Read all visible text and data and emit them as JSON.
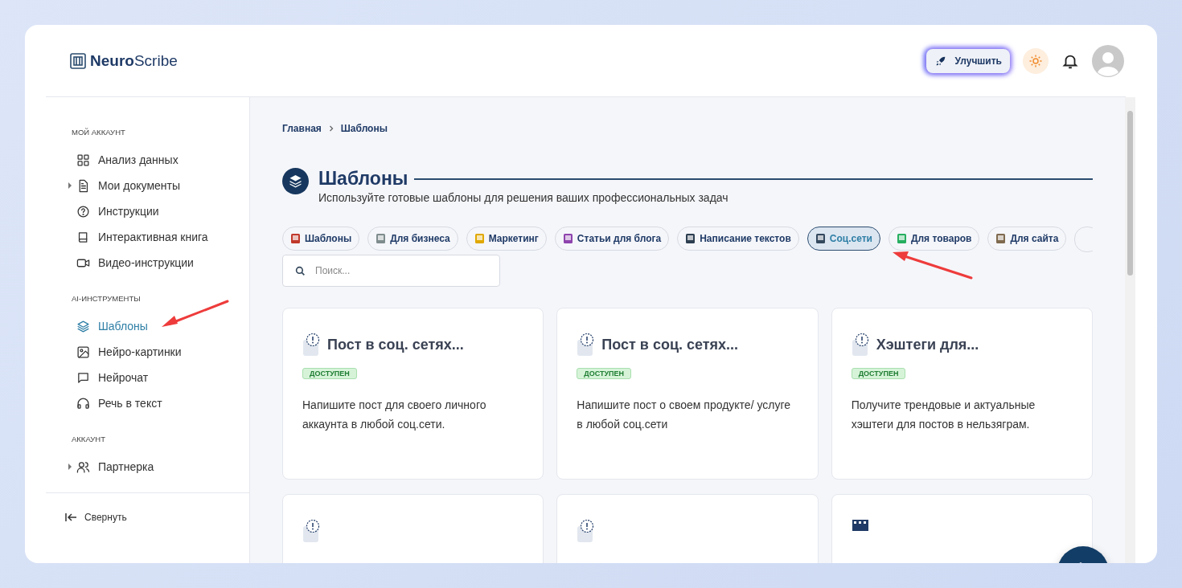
{
  "logo": {
    "bold": "Neuro",
    "light": "Scribe"
  },
  "header": {
    "upgrade_button": "Улучшить"
  },
  "sidebar": {
    "sections": [
      {
        "title": "МОЙ АККАУНТ",
        "items": [
          {
            "label": "Анализ данных",
            "expandable": false,
            "selected": false
          },
          {
            "label": "Мои документы",
            "expandable": true,
            "selected": false
          },
          {
            "label": "Инструкции",
            "expandable": false,
            "selected": false
          },
          {
            "label": "Интерактивная книга",
            "expandable": false,
            "selected": false
          },
          {
            "label": "Видео-инструкции",
            "expandable": false,
            "selected": false
          }
        ]
      },
      {
        "title": "AI-ИНСТРУМЕНТЫ",
        "items": [
          {
            "label": "Шаблоны",
            "expandable": false,
            "selected": true
          },
          {
            "label": "Нейро-картинки",
            "expandable": false,
            "selected": false
          },
          {
            "label": "Нейрочат",
            "expandable": false,
            "selected": false
          },
          {
            "label": "Речь в текст",
            "expandable": false,
            "selected": false
          }
        ]
      },
      {
        "title": "АККАУНТ",
        "items": [
          {
            "label": "Партнерка",
            "expandable": true,
            "selected": false
          }
        ]
      }
    ],
    "collapse": "Свернуть"
  },
  "breadcrumb": [
    "Главная",
    "Шаблоны"
  ],
  "page": {
    "title": "Шаблоны",
    "subtitle": "Используйте готовые шаблоны для решения ваших профессиональных задач"
  },
  "chips": [
    {
      "label": "Шаблоны",
      "selected": false
    },
    {
      "label": "Для бизнеса",
      "selected": false
    },
    {
      "label": "Маркетинг",
      "selected": false
    },
    {
      "label": "Статьи для блога",
      "selected": false
    },
    {
      "label": "Написание текстов",
      "selected": false
    },
    {
      "label": "Соц.сети",
      "selected": true
    },
    {
      "label": "Для товаров",
      "selected": false
    },
    {
      "label": "Для сайта",
      "selected": false
    }
  ],
  "search": {
    "placeholder": "Поиск..."
  },
  "cards": [
    {
      "title": "Пост в соц. сетях...",
      "badge": "ДОСТУПЕН",
      "description": "Напишите пост для своего личного аккаунта в любой соц.сети."
    },
    {
      "title": "Пост в соц. сетях...",
      "badge": "ДОСТУПЕН",
      "description": "Напишите пост о своем продукте/ услуге в любой соц.сети"
    },
    {
      "title": "Хэштеги для...",
      "badge": "ДОСТУПЕН",
      "description": "Получите трендовые и актуальные хэштеги для постов в нельзяграм."
    }
  ]
}
